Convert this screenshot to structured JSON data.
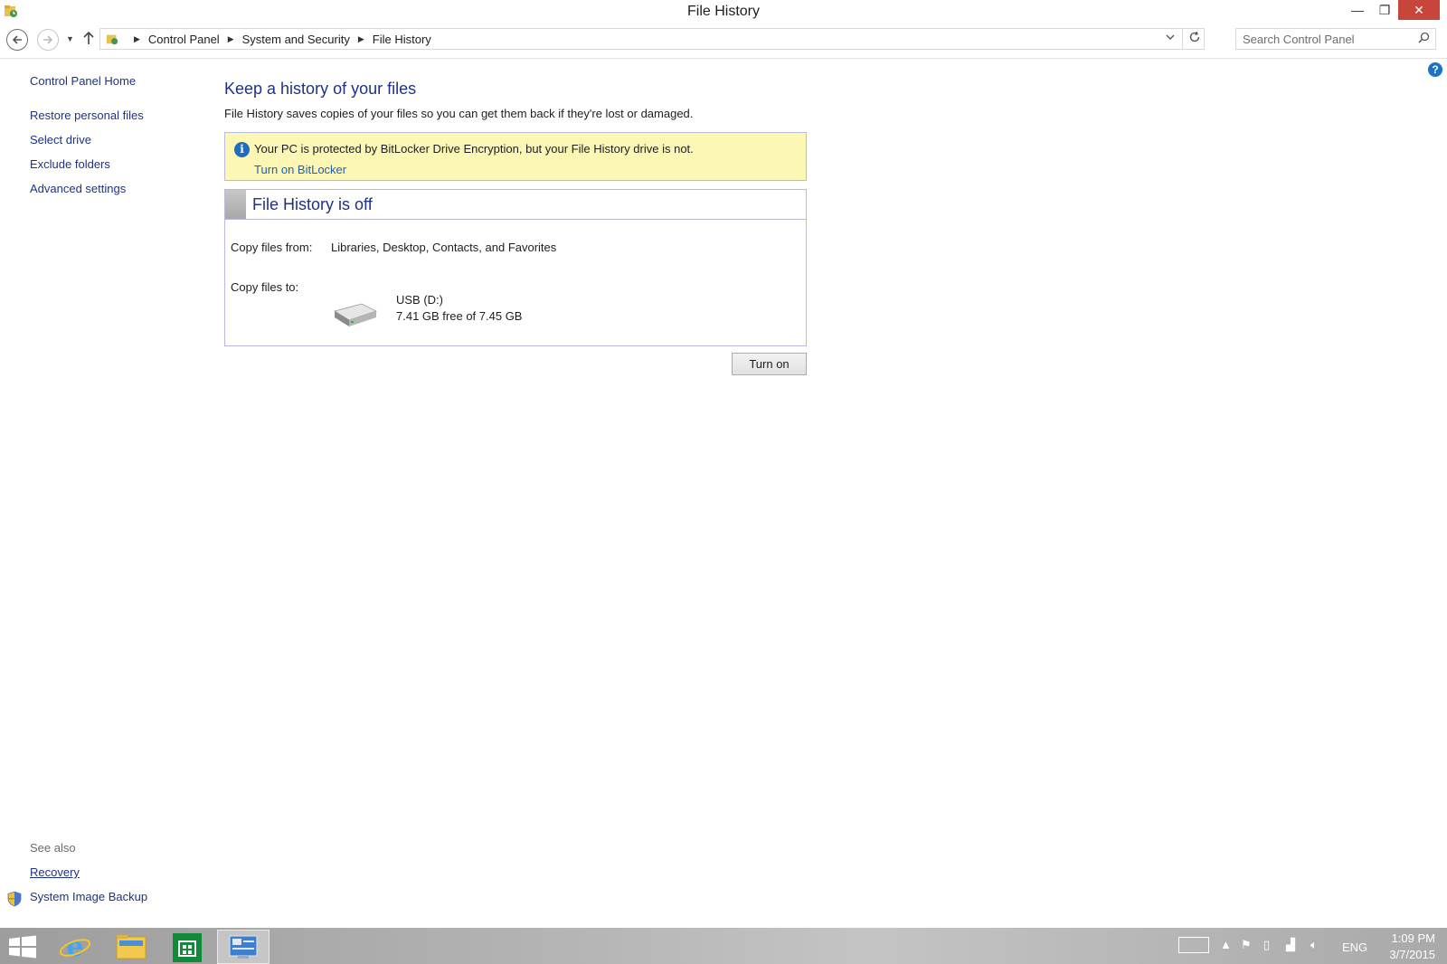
{
  "window": {
    "title": "File History",
    "minimize_glyph": "—",
    "maximize_glyph": "❐",
    "close_glyph": "✕"
  },
  "address": {
    "breadcrumbs": [
      "Control Panel",
      "System and Security",
      "File History"
    ],
    "search_placeholder": "Search Control Panel"
  },
  "sidebar": {
    "home": "Control Panel Home",
    "items": [
      {
        "label": "Restore personal files"
      },
      {
        "label": "Select drive"
      },
      {
        "label": "Exclude folders"
      },
      {
        "label": "Advanced settings"
      }
    ],
    "see_also_label": "See also",
    "see_also": [
      {
        "label": "Recovery"
      },
      {
        "label": "System Image Backup"
      }
    ]
  },
  "main": {
    "title": "Keep a history of your files",
    "description": "File History saves copies of your files so you can get them back if they're lost or damaged.",
    "info_bar": {
      "message": "Your PC is protected by BitLocker Drive Encryption, but your File History drive is not.",
      "link": "Turn on BitLocker"
    },
    "status": {
      "title": "File History is off",
      "copy_from_label": "Copy files from:",
      "copy_from_value": "Libraries, Desktop, Contacts, and Favorites",
      "copy_to_label": "Copy files to:",
      "drive_name": "USB (D:)",
      "drive_space": "7.41 GB free of 7.45 GB"
    },
    "turn_on_button": "Turn on"
  },
  "taskbar": {
    "language": "ENG",
    "time": "1:09 PM",
    "date": "3/7/2015"
  },
  "colors": {
    "link_blue": "#1e3287",
    "info_bar_bg": "#fcf7b5",
    "close_button": "#c7453a",
    "panel_border": "#b8b8e0"
  }
}
